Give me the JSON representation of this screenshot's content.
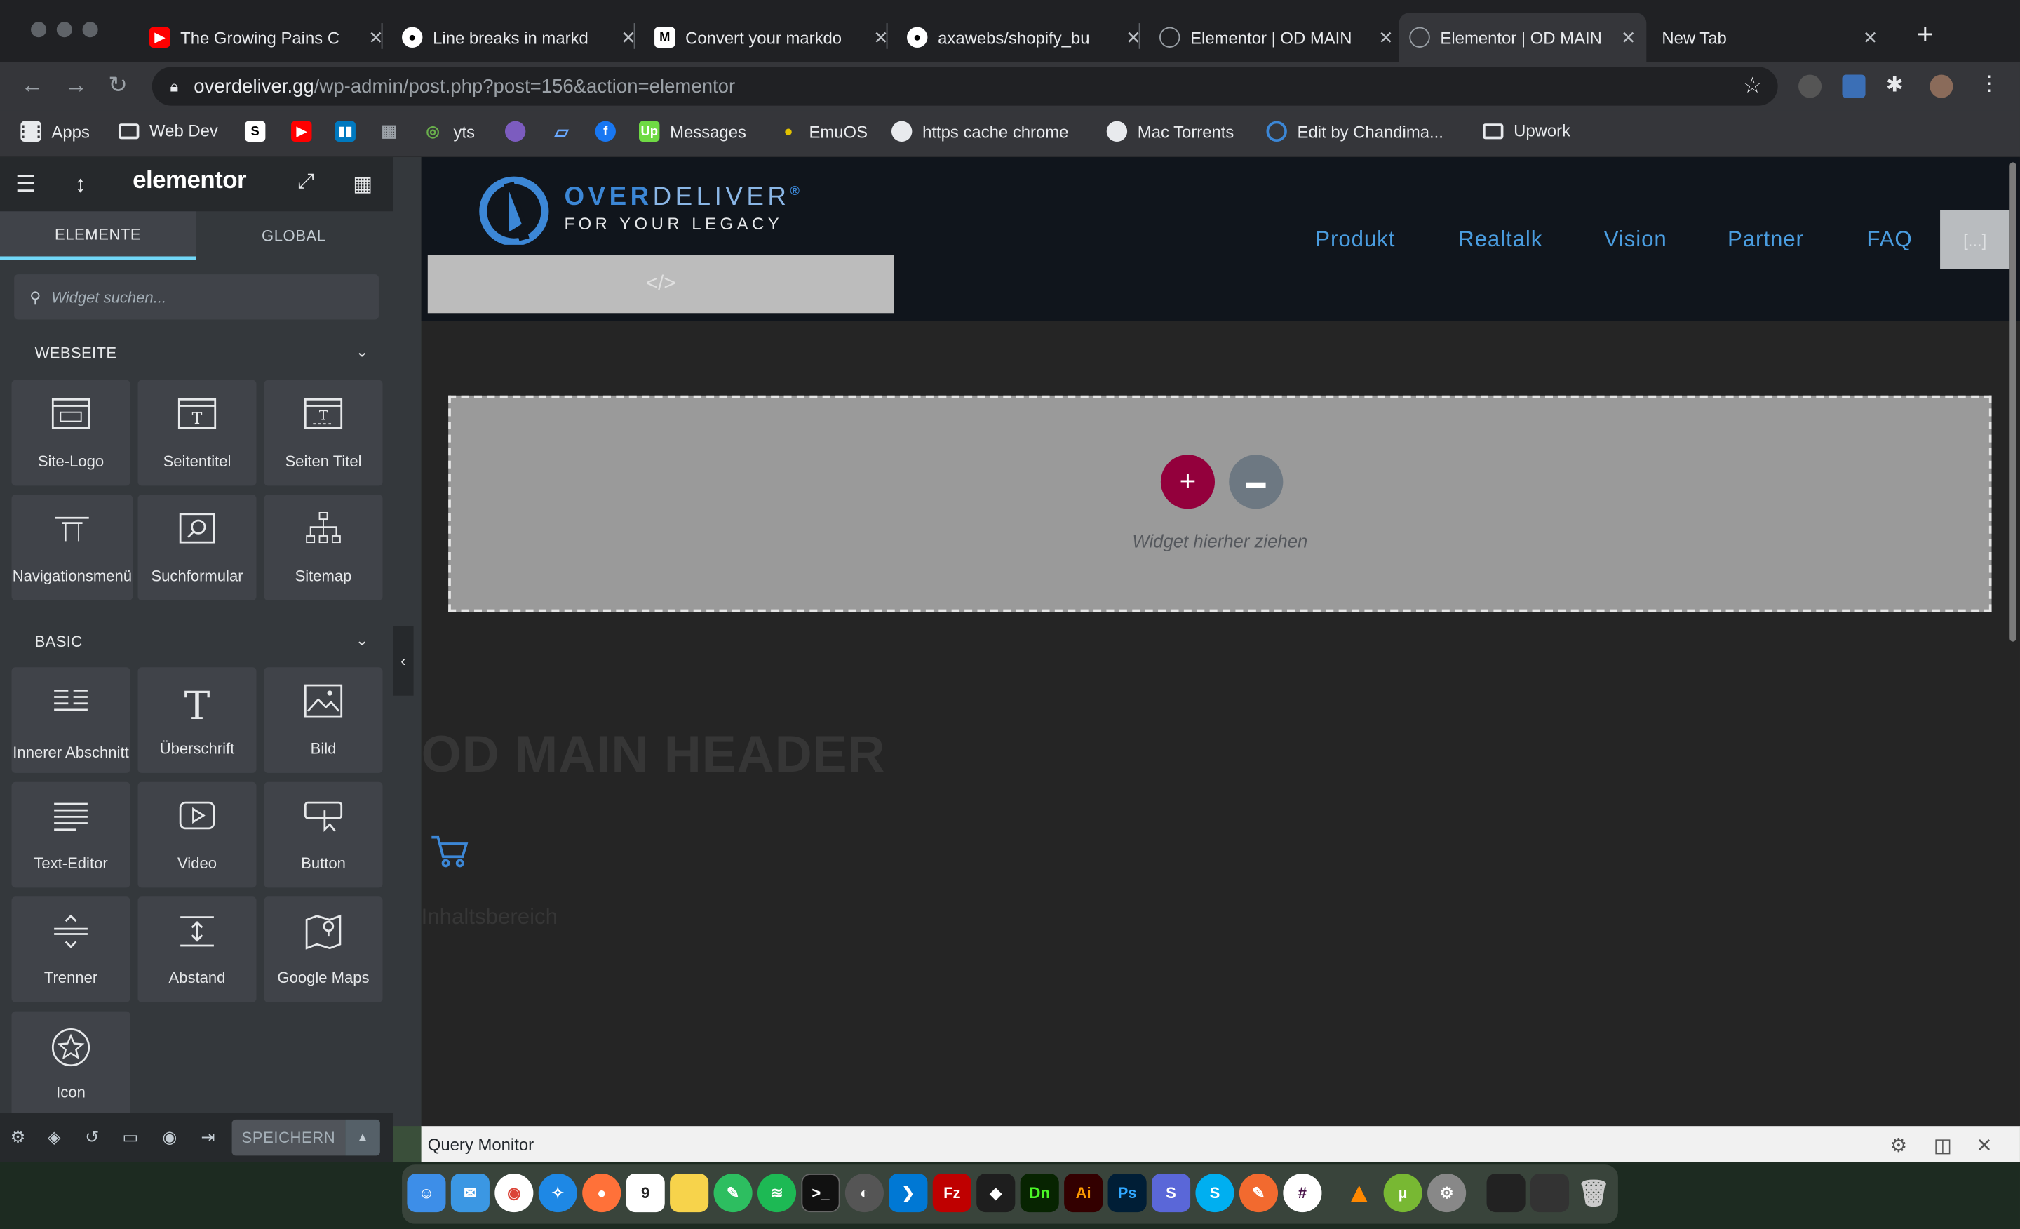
{
  "browser": {
    "tabs": [
      {
        "title": "The Growing Pains C",
        "favicon": "youtube-icon",
        "color": "#ff0000"
      },
      {
        "title": "Line breaks in markd",
        "favicon": "github-icon",
        "color": "#ffffff"
      },
      {
        "title": "Convert your markdo",
        "favicon": "medium-icon",
        "color": "#ffffff"
      },
      {
        "title": "axawebs/shopify_bu",
        "favicon": "github-icon",
        "color": "#ffffff"
      },
      {
        "title": "Elementor | OD MAIN",
        "favicon": "globe-icon",
        "color": "#9aa0a6"
      },
      {
        "title": "Elementor | OD MAIN",
        "favicon": "globe-icon",
        "color": "#9aa0a6"
      },
      {
        "title": "New Tab",
        "favicon": "",
        "color": ""
      }
    ],
    "address": {
      "host": "overdeliver.gg",
      "path": "/wp-admin/post.php?post=156&action=elementor"
    },
    "bookmarks": [
      {
        "label": "Apps",
        "icon": "apps-grid-icon"
      },
      {
        "label": "Web Dev",
        "icon": "folder-icon"
      },
      {
        "label": "",
        "icon": "bookmark-s-icon"
      },
      {
        "label": "",
        "icon": "youtube-icon"
      },
      {
        "label": "",
        "icon": "trello-icon"
      },
      {
        "label": "",
        "icon": "grid-icon"
      },
      {
        "label": "yts",
        "icon": "yts-icon"
      },
      {
        "label": "",
        "icon": "orb-icon"
      },
      {
        "label": "",
        "icon": "ruler-icon"
      },
      {
        "label": "",
        "icon": "facebook-icon"
      },
      {
        "label": "Messages",
        "icon": "upwork-icon"
      },
      {
        "label": "EmuOS",
        "icon": "emuos-icon"
      },
      {
        "label": "https cache chrome",
        "icon": "globe-icon"
      },
      {
        "label": "Mac Torrents",
        "icon": "globe-icon"
      },
      {
        "label": "Edit by Chandima...",
        "icon": "edit-icon"
      },
      {
        "label": "Upwork",
        "icon": "folder-icon"
      }
    ]
  },
  "panel": {
    "brand": "elementor",
    "tabs": [
      "ELEMENTE",
      "GLOBAL"
    ],
    "search_placeholder": "Widget suchen...",
    "categories": [
      {
        "title": "WEBSEITE",
        "widgets": [
          {
            "label": "Site-Logo",
            "icon": "site-logo-icon"
          },
          {
            "label": "Seitentitel",
            "icon": "page-title-icon"
          },
          {
            "label": "Seiten Titel",
            "icon": "page-title-alt-icon"
          },
          {
            "label": "Navigationsmenü",
            "icon": "nav-menu-icon"
          },
          {
            "label": "Suchformular",
            "icon": "search-form-icon"
          },
          {
            "label": "Sitemap",
            "icon": "sitemap-icon"
          }
        ]
      },
      {
        "title": "BASIC",
        "widgets": [
          {
            "label": "Innerer Abschnitt",
            "icon": "inner-section-icon"
          },
          {
            "label": "Überschrift",
            "icon": "heading-icon"
          },
          {
            "label": "Bild",
            "icon": "image-icon"
          },
          {
            "label": "Text-Editor",
            "icon": "text-editor-icon"
          },
          {
            "label": "Video",
            "icon": "video-icon"
          },
          {
            "label": "Button",
            "icon": "button-icon"
          },
          {
            "label": "Trenner",
            "icon": "divider-icon"
          },
          {
            "label": "Abstand",
            "icon": "spacer-icon"
          },
          {
            "label": "Google Maps",
            "icon": "google-maps-icon"
          },
          {
            "label": "Icon",
            "icon": "star-icon"
          }
        ]
      }
    ],
    "save_label": "SPEICHERN"
  },
  "canvas": {
    "logo": {
      "line1_bold": "OVER",
      "line1_light": "DELIVER",
      "reg": "®",
      "line2": "FOR YOUR LEGACY"
    },
    "html_placeholder": "</>",
    "nav": [
      "Produkt",
      "Realtalk",
      "Vision",
      "Partner",
      "FAQ"
    ],
    "nav_extra": "[...]",
    "drop_text": "Widget hierher ziehen",
    "heading": "OD MAIN HEADER",
    "content_area": "Inhaltsbereich"
  },
  "query_monitor": {
    "title": "Query Monitor"
  },
  "colors": {
    "accent_blue": "#4a9de0",
    "add_button": "#93003c",
    "panel_bg": "#34383c",
    "active_tab_underline": "#71d7f7"
  }
}
